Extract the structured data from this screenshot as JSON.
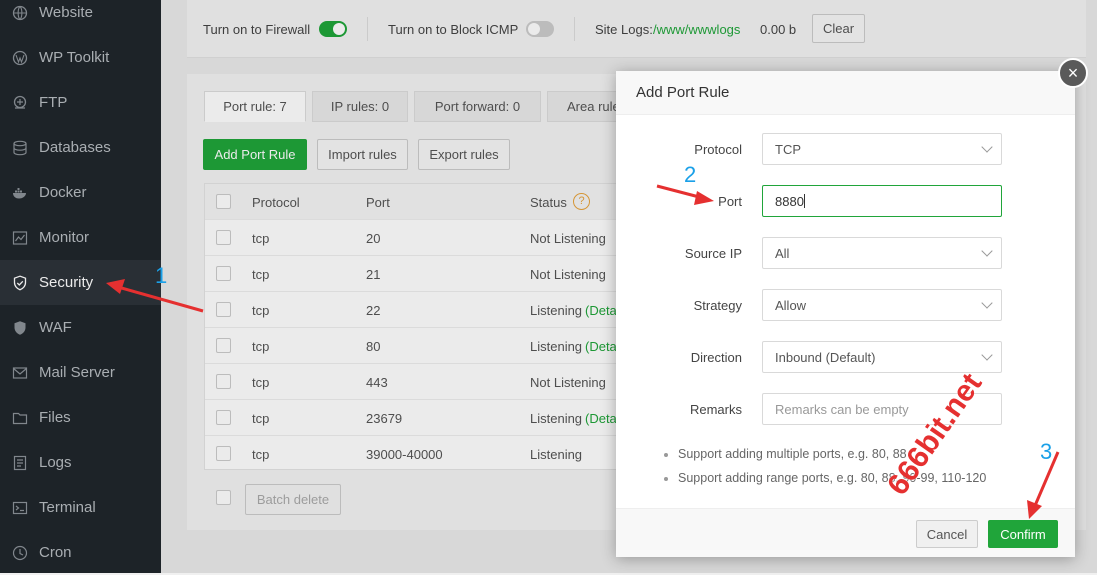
{
  "sidebar": {
    "items": [
      {
        "label": "Website",
        "icon": "globe-icon"
      },
      {
        "label": "WP Toolkit",
        "icon": "wordpress-icon"
      },
      {
        "label": "FTP",
        "icon": "ftp-icon"
      },
      {
        "label": "Databases",
        "icon": "database-icon"
      },
      {
        "label": "Docker",
        "icon": "docker-icon"
      },
      {
        "label": "Monitor",
        "icon": "monitor-icon"
      },
      {
        "label": "Security",
        "icon": "shield-icon",
        "active": true
      },
      {
        "label": "WAF",
        "icon": "waf-shield-icon"
      },
      {
        "label": "Mail Server",
        "icon": "mail-icon"
      },
      {
        "label": "Files",
        "icon": "folder-icon"
      },
      {
        "label": "Logs",
        "icon": "logs-icon"
      },
      {
        "label": "Terminal",
        "icon": "terminal-icon"
      },
      {
        "label": "Cron",
        "icon": "clock-icon"
      }
    ]
  },
  "topbar": {
    "firewall_label": "Turn on to Firewall",
    "firewall_on": true,
    "icmp_label": "Turn on to Block ICMP",
    "icmp_on": false,
    "site_logs_label": "Site Logs:",
    "site_logs_path": "/www/wwwlogs",
    "site_logs_size": "0.00 b",
    "clear_label": "Clear"
  },
  "tabs": [
    {
      "label": "Port rule: 7",
      "active": true
    },
    {
      "label": "IP rules: 0"
    },
    {
      "label": "Port forward: 0"
    },
    {
      "label": "Area rule"
    }
  ],
  "toolbar": {
    "add_label": "Add Port Rule",
    "import_label": "Import rules",
    "export_label": "Export rules"
  },
  "table": {
    "headers": {
      "protocol": "Protocol",
      "port": "Port",
      "status": "Status"
    },
    "rows": [
      {
        "protocol": "tcp",
        "port": "20",
        "status": "Not Listening",
        "detail": ""
      },
      {
        "protocol": "tcp",
        "port": "21",
        "status": "Not Listening",
        "detail": ""
      },
      {
        "protocol": "tcp",
        "port": "22",
        "status": "Listening",
        "detail": "(Deta"
      },
      {
        "protocol": "tcp",
        "port": "80",
        "status": "Listening",
        "detail": "(Deta"
      },
      {
        "protocol": "tcp",
        "port": "443",
        "status": "Not Listening",
        "detail": ""
      },
      {
        "protocol": "tcp",
        "port": "23679",
        "status": "Listening",
        "detail": "(Deta"
      },
      {
        "protocol": "tcp",
        "port": "39000-40000",
        "status": "Listening",
        "detail": ""
      }
    ],
    "batch_delete_label": "Batch delete"
  },
  "modal": {
    "title": "Add Port Rule",
    "protocol_label": "Protocol",
    "protocol_value": "TCP",
    "port_label": "Port",
    "port_value": "8880",
    "source_ip_label": "Source IP",
    "source_ip_value": "All",
    "strategy_label": "Strategy",
    "strategy_value": "Allow",
    "direction_label": "Direction",
    "direction_value": "Inbound (Default)",
    "remarks_label": "Remarks",
    "remarks_placeholder": "Remarks can be empty",
    "tips": [
      "Support adding multiple ports, e.g. 80, 88",
      "Support adding range ports, e.g. 80, 88, 90-99, 110-120"
    ],
    "cancel_label": "Cancel",
    "confirm_label": "Confirm",
    "close_symbol": "×"
  },
  "annotations": {
    "step1": "1",
    "step2": "2",
    "step3": "3",
    "watermark": "666bit.net"
  },
  "colors": {
    "accent": "#20a53a",
    "sidebar_bg": "#20262c",
    "annotation_arrow": "#e53030",
    "annotation_number": "#1aa0e8"
  }
}
